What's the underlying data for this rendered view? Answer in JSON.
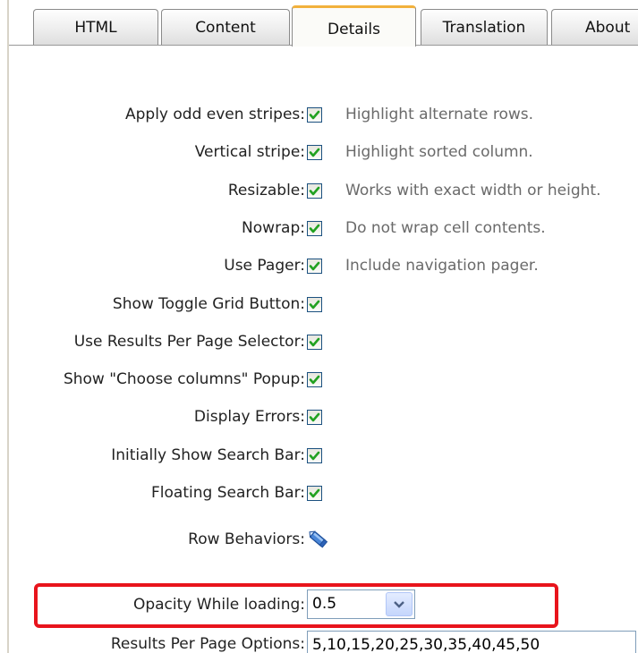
{
  "tabs": [
    {
      "label": "HTML"
    },
    {
      "label": "Content"
    },
    {
      "label": "Details"
    },
    {
      "label": "Translation"
    },
    {
      "label": "About"
    }
  ],
  "active_tab": "Details",
  "checkbox_rows": [
    {
      "label": "Apply odd even stripes:",
      "checked": true,
      "hint": "Highlight alternate rows."
    },
    {
      "label": "Vertical stripe:",
      "checked": true,
      "hint": "Highlight sorted column."
    },
    {
      "label": "Resizable:",
      "checked": true,
      "hint": "Works with exact width or height."
    },
    {
      "label": "Nowrap:",
      "checked": true,
      "hint": "Do not wrap cell contents."
    },
    {
      "label": "Use Pager:",
      "checked": true,
      "hint": "Include navigation pager."
    },
    {
      "label": "Show Toggle Grid Button:",
      "checked": true
    },
    {
      "label": "Use Results Per Page Selector:",
      "checked": true
    },
    {
      "label": "Show \"Choose columns\" Popup:",
      "checked": true
    },
    {
      "label": "Display Errors:",
      "checked": true
    },
    {
      "label": "Initially Show Search Bar:",
      "checked": true
    },
    {
      "label": "Floating Search Bar:",
      "checked": true
    }
  ],
  "row_behaviors": {
    "label": "Row Behaviors:",
    "icon": "edit-pencil-icon"
  },
  "opacity": {
    "label": "Opacity While loading:",
    "value": "0.5"
  },
  "results_per_page": {
    "label": "Results Per Page Options:",
    "value": "5,10,15,20,25,30,35,40,45,50"
  },
  "colors": {
    "highlight_border": "#e8141c",
    "active_tab_accent": "#f2b13c",
    "checkmark": "#21a121"
  }
}
